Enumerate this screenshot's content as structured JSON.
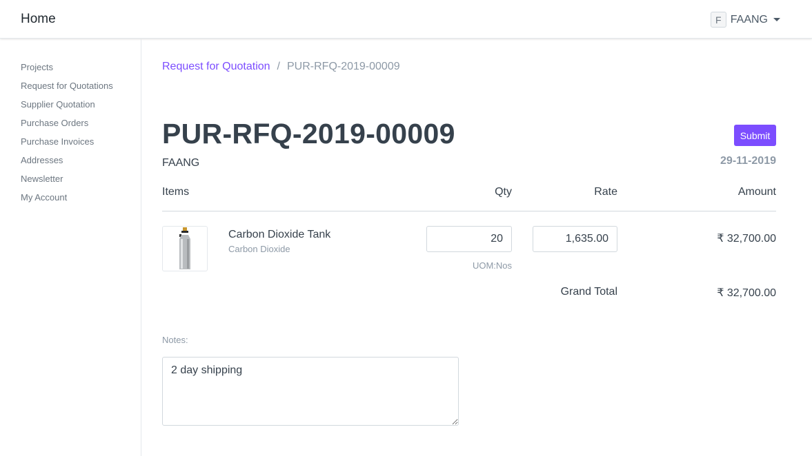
{
  "navbar": {
    "brand": "Home",
    "user_initial": "F",
    "user_name": "FAANG"
  },
  "sidebar": {
    "items": [
      {
        "label": "Projects"
      },
      {
        "label": "Request for Quotations"
      },
      {
        "label": "Supplier Quotation"
      },
      {
        "label": "Purchase Orders"
      },
      {
        "label": "Purchase Invoices"
      },
      {
        "label": "Addresses"
      },
      {
        "label": "Newsletter"
      },
      {
        "label": "My Account"
      }
    ]
  },
  "breadcrumb": {
    "parent": "Request for Quotation",
    "separator": "/",
    "current": "PUR-RFQ-2019-00009"
  },
  "document": {
    "title": "PUR-RFQ-2019-00009",
    "submit_label": "Submit",
    "supplier": "FAANG",
    "date": "29-11-2019"
  },
  "table": {
    "headers": {
      "items": "Items",
      "qty": "Qty",
      "rate": "Rate",
      "amount": "Amount"
    },
    "rows": [
      {
        "item_name": "Carbon Dioxide Tank",
        "item_code": "Carbon Dioxide",
        "qty": "20",
        "uom": "UOM:Nos",
        "rate": "1,635.00",
        "amount": "₹ 32,700.00"
      }
    ],
    "grand_total_label": "Grand Total",
    "grand_total_value": "₹ 32,700.00"
  },
  "notes": {
    "label": "Notes:",
    "value": "2 day shipping"
  },
  "colors": {
    "accent": "#7c4dff",
    "text": "#36414c",
    "muted": "#8d99a6"
  }
}
